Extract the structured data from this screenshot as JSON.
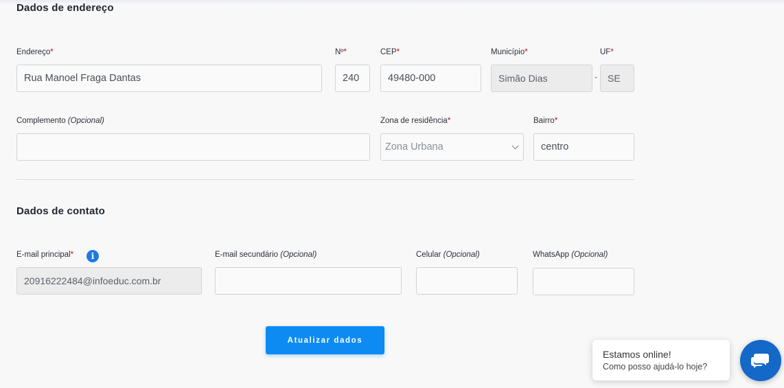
{
  "address_section": {
    "title": "Dados de endereço",
    "endereco": {
      "label": "Endereço",
      "required": "*",
      "value": "Rua Manoel Fraga Dantas"
    },
    "numero": {
      "label": "Nº",
      "required": "*",
      "value": "240"
    },
    "cep": {
      "label": "CEP",
      "required": "*",
      "value": "49480-000"
    },
    "municipio": {
      "label": "Município",
      "required": "*",
      "value": "Simão Dias"
    },
    "separator": "-",
    "uf": {
      "label": "UF",
      "required": "*",
      "value": "SE"
    },
    "complemento": {
      "label": "Complemento",
      "optional": "(Opcional)",
      "value": ""
    },
    "zona": {
      "label": "Zona de residência",
      "required": "*",
      "value": "Zona Urbana"
    },
    "bairro": {
      "label": "Bairro",
      "required": "*",
      "value": "centro"
    }
  },
  "contact_section": {
    "title": "Dados de contato",
    "email_principal": {
      "label": "E-mail principal",
      "required": "*",
      "info_glyph": "i",
      "value": "20916222484@infoeduc.com.br"
    },
    "email_secundario": {
      "label": "E-mail secundário",
      "optional": "(Opcional)",
      "value": ""
    },
    "celular": {
      "label": "Celular",
      "optional": "(Opcional)",
      "value": ""
    },
    "whatsapp": {
      "label": "WhatsApp",
      "optional": "(Opcional)",
      "value": ""
    }
  },
  "submit_button": "Atualizar dados",
  "chat": {
    "line1": "Estamos online!",
    "line2": "Como posso ajudá-lo hoje?",
    "icon": "chat-icon"
  },
  "colors": {
    "primary": "#0d8bf2",
    "required": "#d0021b",
    "chat": "#1468c8",
    "info": "#1f7ae0"
  }
}
